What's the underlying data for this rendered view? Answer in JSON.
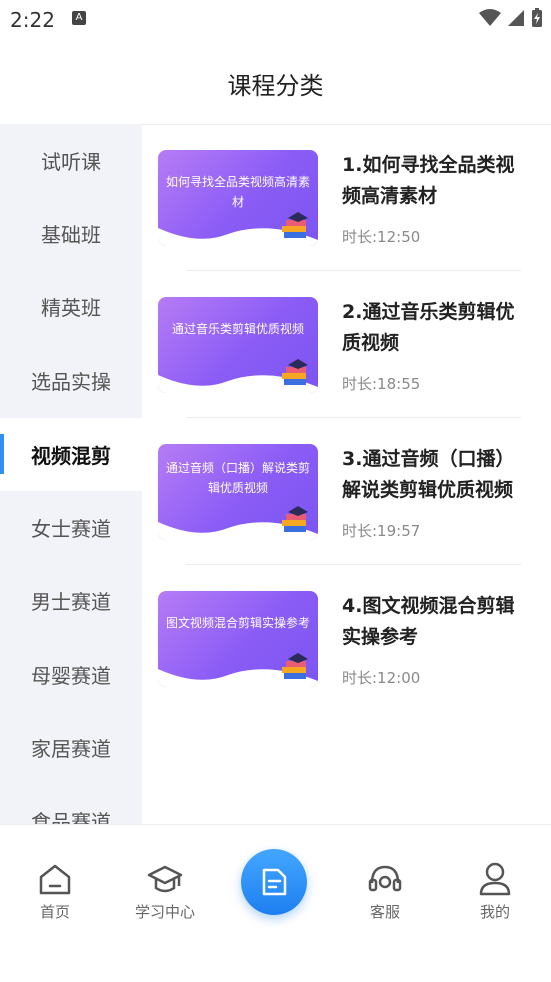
{
  "status_bar": {
    "time": "2:22",
    "notification_icon": "text-notification-icon",
    "icons": [
      "wifi-icon",
      "signal-icon",
      "battery-charging-icon"
    ]
  },
  "header": {
    "title": "课程分类"
  },
  "sidebar": {
    "items": [
      {
        "label": "试听课",
        "active": false
      },
      {
        "label": "基础班",
        "active": false
      },
      {
        "label": "精英班",
        "active": false
      },
      {
        "label": "选品实操",
        "active": false
      },
      {
        "label": "视频混剪",
        "active": true
      },
      {
        "label": "女士赛道",
        "active": false
      },
      {
        "label": "男士赛道",
        "active": false
      },
      {
        "label": "母婴赛道",
        "active": false
      },
      {
        "label": "家居赛道",
        "active": false
      },
      {
        "label": "食品赛道",
        "active": false
      }
    ],
    "active_color": "#2f8ff3"
  },
  "courses": [
    {
      "thumb_text": "如何寻找全品类视频高清素材",
      "title": "1.如何寻找全品类视频高清素材",
      "duration": "时长:12:50"
    },
    {
      "thumb_text": "通过音乐类剪辑优质视频",
      "title": "2.通过音乐类剪辑优质视频",
      "duration": "时长:18:55"
    },
    {
      "thumb_text": "通过音频（口播）解说类剪辑优质视频",
      "title": "3.通过音频（口播）解说类剪辑优质视频",
      "duration": "时长:19:57"
    },
    {
      "thumb_text": "图文视频混合剪辑实操参考",
      "title": "4.图文视频混合剪辑实操参考",
      "duration": "时长:12:00"
    }
  ],
  "bottom_nav": {
    "items": [
      {
        "label": "首页",
        "icon": "home-icon"
      },
      {
        "label": "学习中心",
        "icon": "graduation-cap-icon"
      },
      {
        "label": "",
        "icon": "document-icon"
      },
      {
        "label": "客服",
        "icon": "headset-icon"
      },
      {
        "label": "我的",
        "icon": "user-icon"
      }
    ],
    "center_color": "#2f8ff3"
  }
}
